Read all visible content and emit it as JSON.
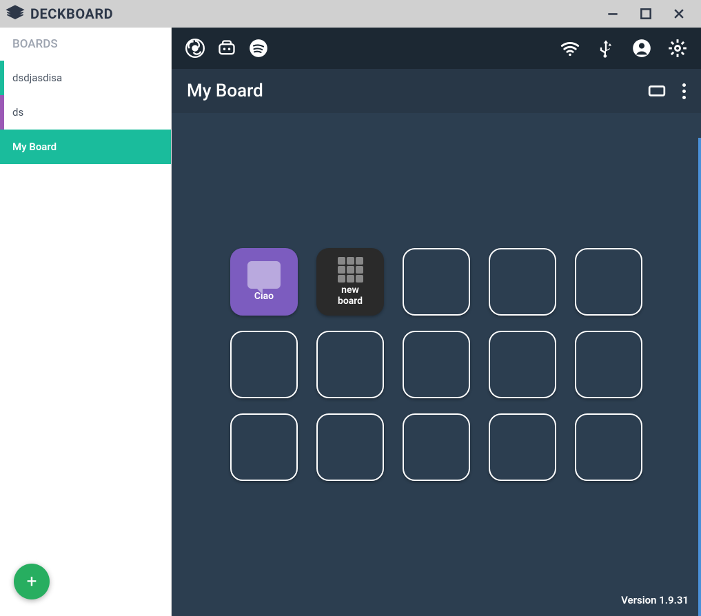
{
  "titlebar": {
    "app_name": "DECKBOARD"
  },
  "sidebar": {
    "header": "BOARDS",
    "items": [
      {
        "label": "dsdjasdisa",
        "accent": "teal",
        "active": false
      },
      {
        "label": "ds",
        "accent": "purple",
        "active": false
      },
      {
        "label": "My Board",
        "accent": "active",
        "active": true
      }
    ]
  },
  "board": {
    "title": "My Board"
  },
  "tiles": [
    {
      "type": "purple",
      "label": "Ciao",
      "icon": "chat"
    },
    {
      "type": "dark",
      "label": "new\nboard",
      "icon": "grid"
    },
    {
      "type": "empty"
    },
    {
      "type": "empty"
    },
    {
      "type": "empty"
    },
    {
      "type": "empty"
    },
    {
      "type": "empty"
    },
    {
      "type": "empty"
    },
    {
      "type": "empty"
    },
    {
      "type": "empty"
    },
    {
      "type": "empty"
    },
    {
      "type": "empty"
    },
    {
      "type": "empty"
    },
    {
      "type": "empty"
    },
    {
      "type": "empty"
    }
  ],
  "footer": {
    "version": "Version 1.9.31"
  },
  "toolbar_icons": {
    "obs": "obs-icon",
    "streamlabs": "streamlabs-icon",
    "spotify": "spotify-icon",
    "wifi": "wifi-icon",
    "usb": "usb-icon",
    "account": "account-icon",
    "settings": "settings-icon"
  }
}
